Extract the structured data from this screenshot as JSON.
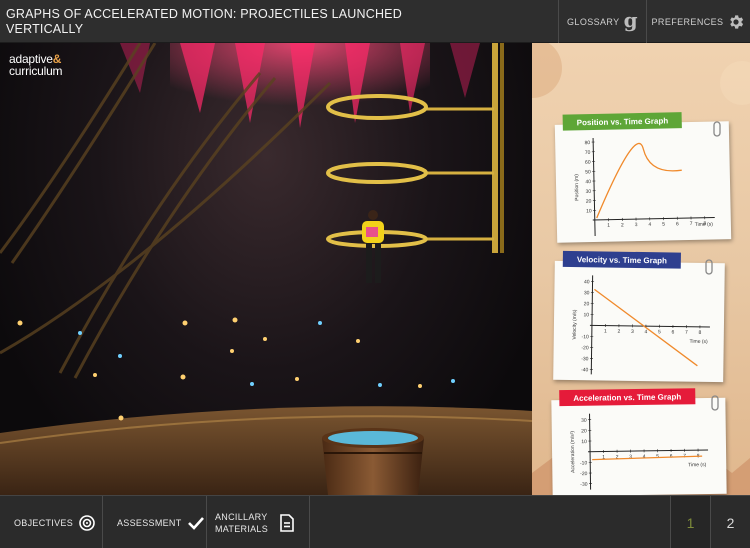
{
  "header": {
    "title": "GRAPHS OF ACCELERATED MOTION: PROJECTILES LAUNCHED VERTICALLY",
    "glossary_label": "GLOSSARY",
    "preferences_label": "PREFERENCES"
  },
  "scene": {
    "logo_line1": "adaptive",
    "logo_amp": "&",
    "logo_line2": "curriculum"
  },
  "graphs": [
    {
      "tab_label": "Position vs. Time Graph",
      "tab_color": "#5ea637",
      "y_axis_label": "Position (m)",
      "x_axis_label": "Time (s)",
      "y_ticks": [
        "80",
        "70",
        "60",
        "50",
        "40",
        "30",
        "20",
        "10"
      ],
      "x_ticks": [
        "1",
        "2",
        "3",
        "4",
        "5",
        "6",
        "7",
        "8"
      ]
    },
    {
      "tab_label": "Velocity vs. Time Graph",
      "tab_color": "#2e3f8f",
      "y_axis_label": "Velocity (m/s)",
      "x_axis_label": "Time (s)",
      "y_ticks": [
        "40",
        "30",
        "20",
        "10",
        "-10",
        "-20",
        "-30",
        "-40"
      ],
      "x_ticks": [
        "1",
        "2",
        "3",
        "4",
        "5",
        "6",
        "7",
        "8"
      ]
    },
    {
      "tab_label": "Acceleration vs. Time Graph",
      "tab_color": "#e51b3a",
      "y_axis_label": "Acceleration (m/s²)",
      "x_axis_label": "Time (s)",
      "y_ticks": [
        "30",
        "20",
        "10",
        "-10",
        "-20",
        "-30"
      ],
      "x_ticks": [
        "1",
        "2",
        "3",
        "4",
        "5",
        "6",
        "7",
        "8"
      ]
    }
  ],
  "footer": {
    "objectives_label": "OBJECTIVES",
    "assessment_label": "ASSESSMENT",
    "ancillary_line1": "ANCILLARY",
    "ancillary_line2": "MATERIALS",
    "page1": "1",
    "page2": "2"
  },
  "colors": {
    "plot_line": "#f08a2c",
    "page_active": "#7d8a3a"
  }
}
